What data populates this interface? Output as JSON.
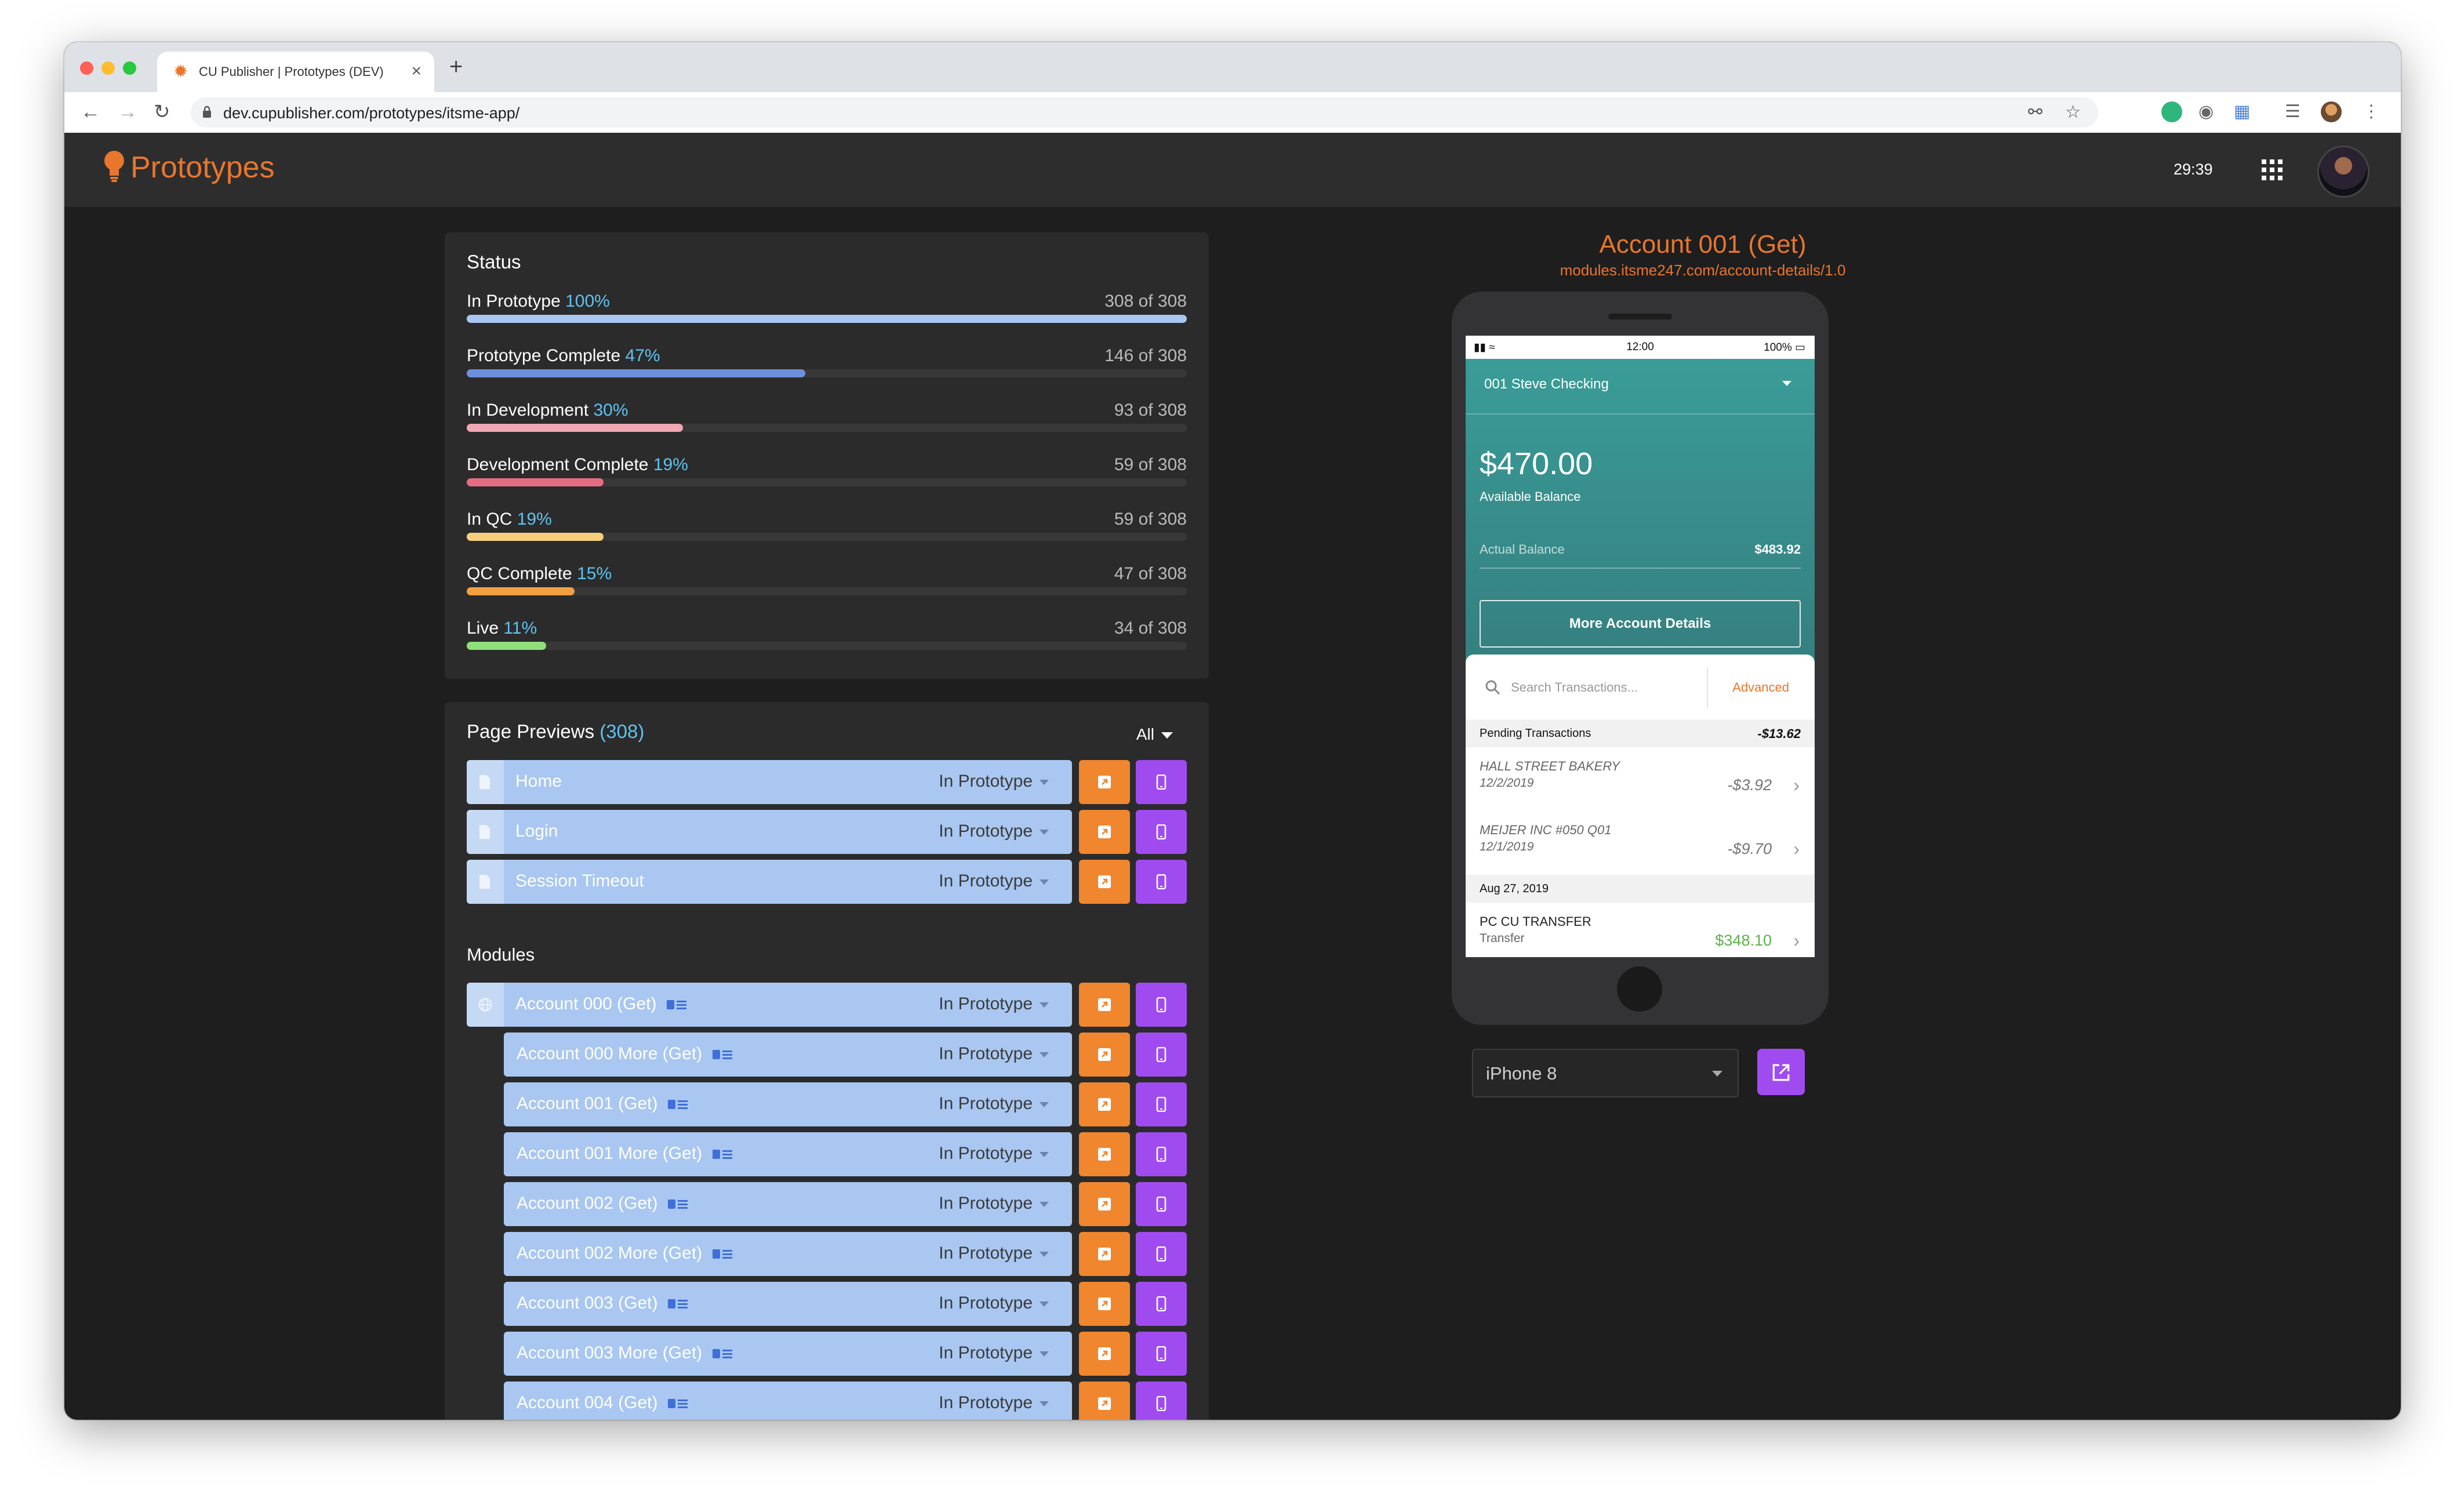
{
  "browser": {
    "tab_title": "CU Publisher | Prototypes (DEV)",
    "url": "dev.cupublisher.com/prototypes/itsme-app/"
  },
  "header": {
    "logo_text": "Prototypes",
    "timer": "29:39",
    "brand_color": "#e8762d"
  },
  "status": {
    "title": "Status",
    "rows": [
      {
        "label": "In Prototype",
        "pct": "100%",
        "count": "308 of 308",
        "value": 1.0,
        "color": "#a9c7f1"
      },
      {
        "label": "Prototype Complete",
        "pct": "47%",
        "count": "146 of 308",
        "value": 0.47,
        "color": "#6e90dc"
      },
      {
        "label": "In Development",
        "pct": "30%",
        "count": "93 of 308",
        "value": 0.3,
        "color": "#f0a7b4"
      },
      {
        "label": "Development Complete",
        "pct": "19%",
        "count": "59 of 308",
        "value": 0.19,
        "color": "#e56d83"
      },
      {
        "label": "In QC",
        "pct": "19%",
        "count": "59 of 308",
        "value": 0.19,
        "color": "#f7cf7c"
      },
      {
        "label": "QC Complete",
        "pct": "15%",
        "count": "47 of 308",
        "value": 0.15,
        "color": "#f0a040"
      },
      {
        "label": "Live",
        "pct": "11%",
        "count": "34 of 308",
        "value": 0.11,
        "color": "#8fe07a"
      }
    ]
  },
  "previews": {
    "title": "Page Previews",
    "count": "(308)",
    "filter": "All",
    "pages": [
      {
        "name": "Home",
        "status": "In Prototype"
      },
      {
        "name": "Login",
        "status": "In Prototype"
      },
      {
        "name": "Session Timeout",
        "status": "In Prototype"
      }
    ],
    "modules_label": "Modules",
    "modules": [
      {
        "name": "Account 000 (Get)",
        "status": "In Prototype"
      },
      {
        "name": "Account 000 More (Get)",
        "status": "In Prototype"
      },
      {
        "name": "Account 001 (Get)",
        "status": "In Prototype"
      },
      {
        "name": "Account 001 More (Get)",
        "status": "In Prototype"
      },
      {
        "name": "Account 002 (Get)",
        "status": "In Prototype"
      },
      {
        "name": "Account 002 More (Get)",
        "status": "In Prototype"
      },
      {
        "name": "Account 003 (Get)",
        "status": "In Prototype"
      },
      {
        "name": "Account 003 More (Get)",
        "status": "In Prototype"
      },
      {
        "name": "Account 004 (Get)",
        "status": "In Prototype"
      }
    ]
  },
  "preview": {
    "title": "Account 001 (Get)",
    "url": "modules.itsme247.com/account-details/1.0",
    "device": "iPhone 8",
    "phone": {
      "time": "12:00",
      "battery": "100%",
      "account": "001 Steve Checking",
      "balance": "$470.00",
      "balance_label": "Available Balance",
      "actual_label": "Actual Balance",
      "actual_value": "$483.92",
      "more_button": "More Account Details",
      "search_placeholder": "Search Transactions...",
      "advanced": "Advanced",
      "pending_label": "Pending Transactions",
      "pending_total": "-$13.62",
      "pending": [
        {
          "name": "HALL STREET BAKERY",
          "date": "12/2/2019",
          "amount": "-$3.92"
        },
        {
          "name": "MEIJER INC #050 Q01",
          "date": "12/1/2019",
          "amount": "-$9.70"
        }
      ],
      "date_group": "Aug 27, 2019",
      "posted": [
        {
          "name": "PC CU TRANSFER",
          "date": "Transfer",
          "amount": "$348.10"
        }
      ]
    }
  }
}
